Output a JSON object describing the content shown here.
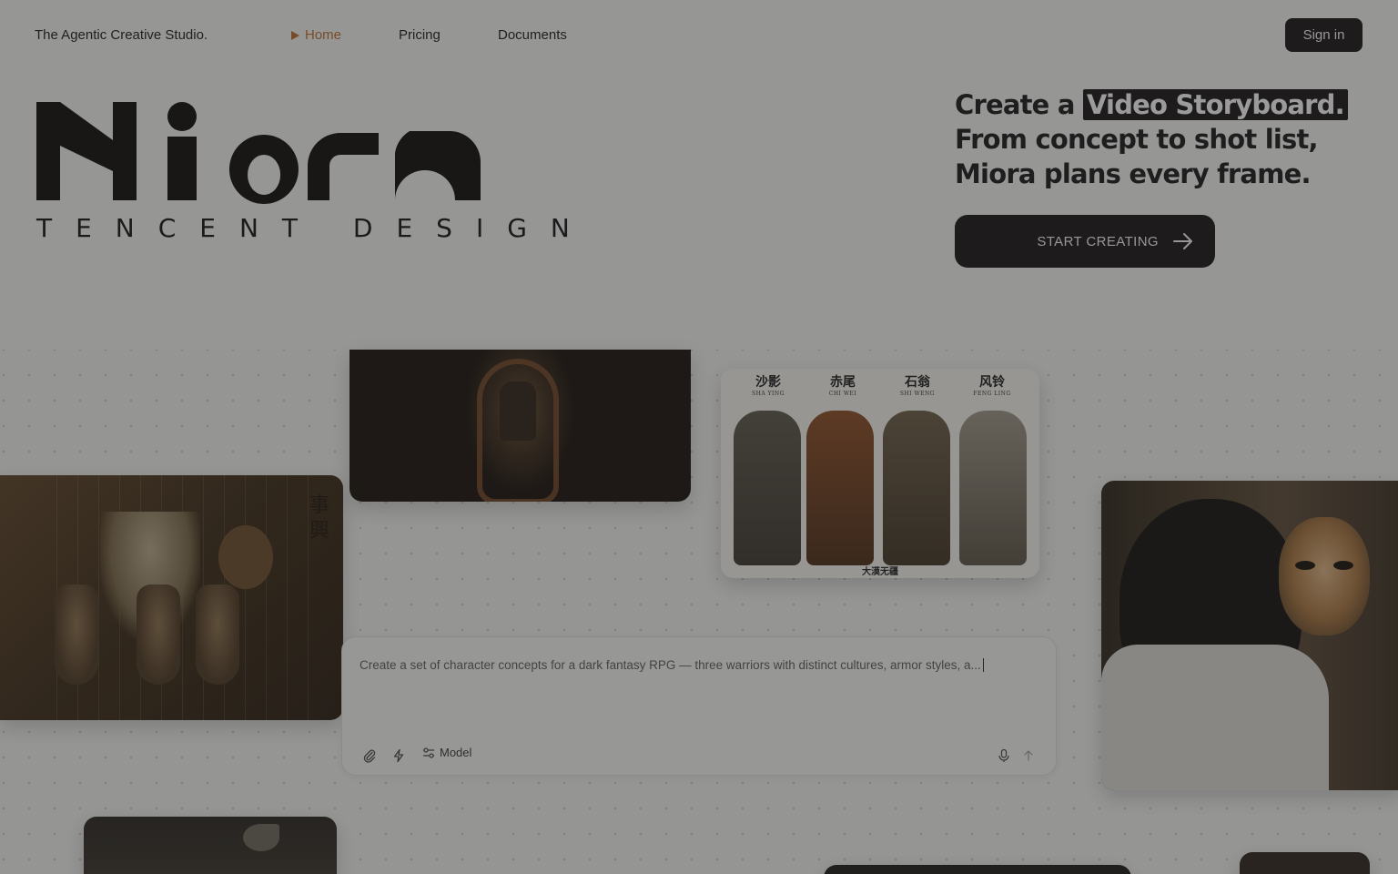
{
  "header": {
    "tagline": "The Agentic Creative Studio.",
    "nav": [
      {
        "label": "Home",
        "active": true
      },
      {
        "label": "Pricing",
        "active": false
      },
      {
        "label": "Documents",
        "active": false
      }
    ],
    "signin_label": "Sign in"
  },
  "logo": {
    "wordmark": "Miora",
    "subtitle": "TENCENT DESIGN"
  },
  "hero": {
    "line1_prefix": "Create a ",
    "highlight": "Video Storyboard.",
    "line2": "From concept to shot list,",
    "line3": "Miora plans every frame.",
    "cta_label": "START CREATING"
  },
  "gallery": {
    "character_sheet": {
      "names": [
        {
          "cn": "沙影",
          "en": "SHA YING"
        },
        {
          "cn": "赤尾",
          "en": "CHI WEI"
        },
        {
          "cn": "石翁",
          "en": "SHI WENG"
        },
        {
          "cn": "风铃",
          "en": "FENG LING"
        }
      ],
      "footer": "大漠无疆"
    },
    "puppet_calligraphy": "事興"
  },
  "prompt": {
    "text": "Create a set of character concepts for a dark fantasy RPG — three warriors with distinct cultures, armor styles, a...",
    "model_label": "Model"
  },
  "colors": {
    "accent": "#b8692a",
    "dark": "#141211",
    "background": "#f0f0ee"
  },
  "icons": {
    "attach": "paperclip-icon",
    "quick": "lightning-icon",
    "model": "sliders-icon",
    "mic": "microphone-icon",
    "send": "arrow-up-icon",
    "cta": "arrow-right-icon"
  }
}
